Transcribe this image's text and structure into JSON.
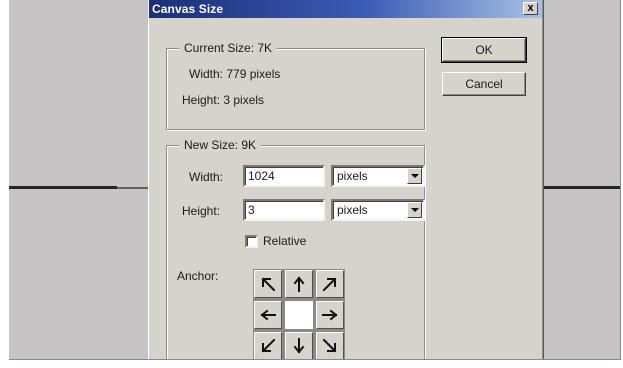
{
  "dialog": {
    "title": "Canvas Size",
    "close_glyph": "x"
  },
  "current_size": {
    "heading": "Current Size:  7K",
    "width_text": "Width:  779 pixels",
    "height_text": "Height:  3 pixels"
  },
  "new_size": {
    "heading": "New Size:  9K",
    "width_label": "Width:",
    "width_value": "1024",
    "width_unit": "pixels",
    "height_label": "Height:",
    "height_value": "3",
    "height_unit": "pixels",
    "relative_label": "Relative",
    "relative_checked": false,
    "anchor_label": "Anchor:",
    "anchor_selected": "center",
    "anchor_cells": [
      {
        "name": "anchor-top-left",
        "icon": "arrow-up-left-icon"
      },
      {
        "name": "anchor-top",
        "icon": "arrow-up-icon"
      },
      {
        "name": "anchor-top-right",
        "icon": "arrow-up-right-icon"
      },
      {
        "name": "anchor-left",
        "icon": "arrow-left-icon"
      },
      {
        "name": "anchor-center",
        "icon": ""
      },
      {
        "name": "anchor-right",
        "icon": "arrow-right-icon"
      },
      {
        "name": "anchor-bottom-left",
        "icon": "arrow-down-left-icon"
      },
      {
        "name": "anchor-bottom",
        "icon": "arrow-down-icon"
      },
      {
        "name": "anchor-bottom-right",
        "icon": "arrow-down-right-icon"
      }
    ]
  },
  "buttons": {
    "ok_label": "OK",
    "cancel_label": "Cancel"
  },
  "colors": {
    "titlebar_start": "#1c2e78",
    "titlebar_end": "#a8c0e6",
    "dialog_face": "#d6d3cc",
    "workspace": "#c6c4c5"
  }
}
